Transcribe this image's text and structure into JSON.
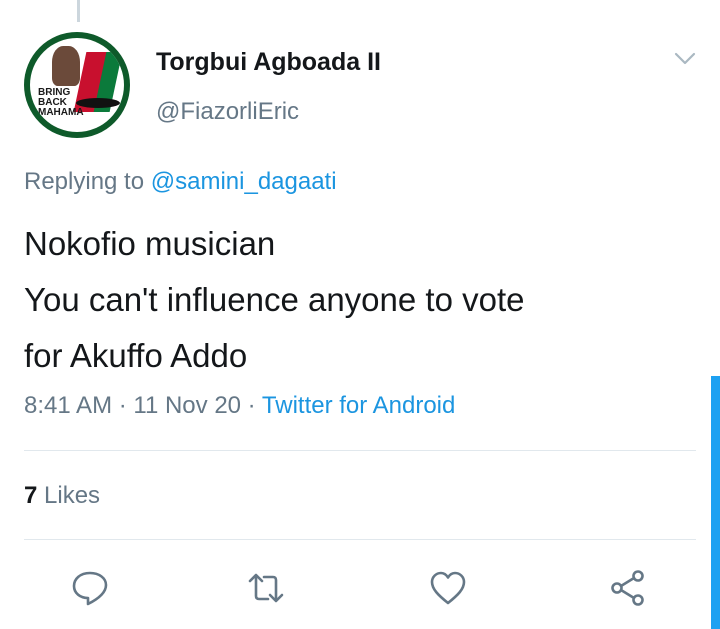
{
  "user": {
    "name": "Torgbui Agboada II",
    "handle": "@FiazorliEric",
    "avatar_text": [
      "BRING",
      "BACK",
      "MAHAMA"
    ]
  },
  "reply": {
    "prefix": "Replying to",
    "target": "@samini_dagaati"
  },
  "tweet": {
    "lines": [
      "Nokofio musician",
      "You can't influence anyone to vote",
      "for Akuffo Addo"
    ]
  },
  "meta": {
    "time": "8:41 AM",
    "sep1": " · ",
    "date": "11 Nov 20",
    "sep2": " · ",
    "source": "Twitter for Android"
  },
  "stats": {
    "likes_count": "7",
    "likes_label": "Likes"
  },
  "actions": [
    "reply-icon",
    "retweet-icon",
    "like-icon",
    "share-icon"
  ],
  "colors": {
    "accent": "#1b95e0",
    "muted": "#657786",
    "text": "#14171a",
    "divider": "#e1e8ed"
  }
}
